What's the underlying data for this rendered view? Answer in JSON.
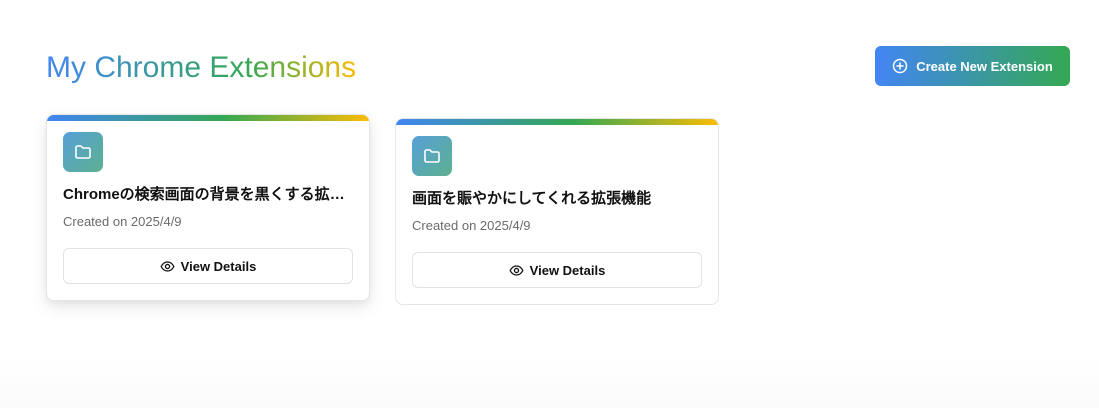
{
  "header": {
    "title": "My Chrome Extensions",
    "create_button_label": "Create New Extension",
    "create_button_icon": "plus-circle-icon"
  },
  "extensions": [
    {
      "name": "Chromeの検索画面の背景を黒くする拡張機能",
      "created": "Created on 2025/4/9",
      "icon": "folder-icon",
      "view_label": "View Details",
      "view_icon": "eye-icon"
    },
    {
      "name": "画面を賑やかにしてくれる拡張機能",
      "created": "Created on 2025/4/9",
      "icon": "folder-icon",
      "view_label": "View Details",
      "view_icon": "eye-icon"
    }
  ],
  "colors": {
    "blue": "#4285f4",
    "green": "#34a853",
    "yellow": "#fbbc05"
  }
}
